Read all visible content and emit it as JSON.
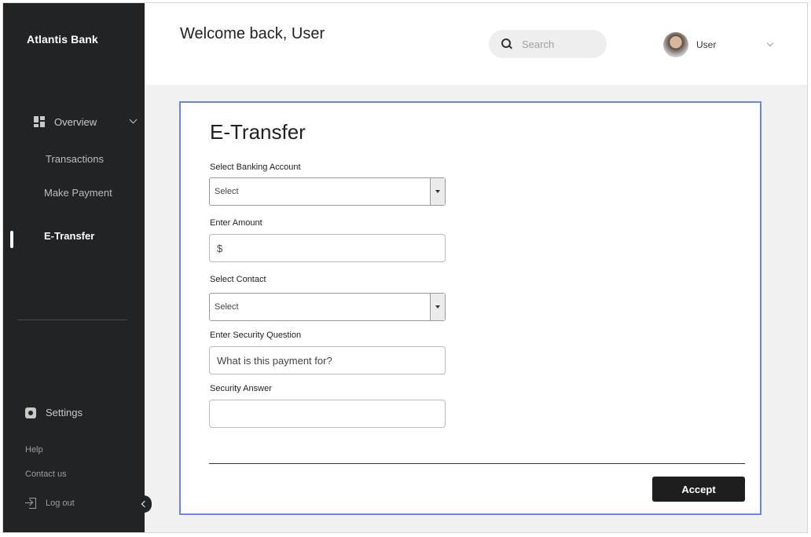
{
  "brand": "Atlantis Bank",
  "sidebar": {
    "overview_label": "Overview",
    "sub_items": [
      {
        "label": "Transactions"
      },
      {
        "label": "Make Payment"
      },
      {
        "label": "E-Transfer",
        "active": true
      }
    ],
    "settings_label": "Settings",
    "help_label": "Help",
    "contact_label": "Contact us",
    "logout_label": "Log out"
  },
  "header": {
    "welcome": "Welcome back, User",
    "search_placeholder": "Search",
    "user_name": "User"
  },
  "form": {
    "title": "E-Transfer",
    "account_label": "Select Banking Account",
    "account_value": "Select",
    "amount_label": "Enter Amount",
    "amount_placeholder": "$",
    "contact_label": "Select Contact",
    "contact_value": "Select",
    "question_label": "Enter Security Question",
    "question_placeholder": "What is this payment for?",
    "answer_label": "Security Answer",
    "answer_placeholder": "",
    "accept_label": "Accept"
  },
  "colors": {
    "sidebar_bg": "#222325",
    "card_border": "#6b87dd",
    "accept_bg": "#1e1e1f"
  }
}
